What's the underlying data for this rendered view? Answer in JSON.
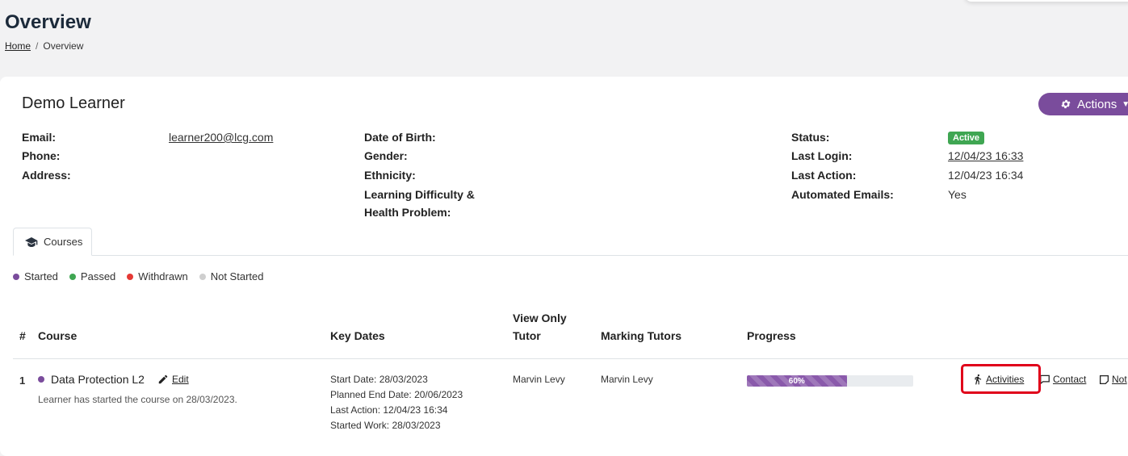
{
  "page": {
    "title": "Overview"
  },
  "breadcrumb": {
    "home": "Home",
    "current": "Overview",
    "separator": "/"
  },
  "learner": {
    "name": "Demo Learner",
    "actions_label": "Actions",
    "col1": [
      {
        "label": "Email:",
        "value": "learner200@lcg.com"
      },
      {
        "label": "Phone:",
        "value": ""
      },
      {
        "label": "Address:",
        "value": ""
      }
    ],
    "col2": [
      {
        "label": "Date of Birth:",
        "value": ""
      },
      {
        "label": "Gender:",
        "value": ""
      },
      {
        "label": "Ethnicity:",
        "value": ""
      },
      {
        "label": "Learning Difficulty &",
        "label2": "Health Problem:",
        "value": ""
      }
    ],
    "col3": [
      {
        "label": "Status:",
        "value": "Active"
      },
      {
        "label": "Last Login:",
        "value": "12/04/23 16:33"
      },
      {
        "label": "Last Action:",
        "value": "12/04/23 16:34"
      },
      {
        "label": "Automated Emails:",
        "value": "Yes"
      }
    ]
  },
  "tabs": [
    {
      "label": "Courses",
      "icon": "graduation-cap-icon"
    }
  ],
  "legend": [
    {
      "label": "Started",
      "color": "#7a4c9c"
    },
    {
      "label": "Passed",
      "color": "#3fa652"
    },
    {
      "label": "Withdrawn",
      "color": "#e53935"
    },
    {
      "label": "Not Started",
      "color": "#cfcfcf"
    }
  ],
  "table": {
    "headers": {
      "num": "#",
      "course": "Course",
      "key_dates": "Key Dates",
      "view_only_1": "View Only",
      "view_only_2": "Tutor",
      "marking": "Marking Tutors",
      "progress": "Progress"
    },
    "rows": [
      {
        "num": "1",
        "course": "Data Protection L2",
        "edit": "Edit",
        "note": "Learner has started the course on 28/03/2023.",
        "dates": [
          "Start Date: 28/03/2023",
          "Planned End Date: 20/06/2023",
          "Last Action: 12/04/23 16:34",
          "Started Work: 28/03/2023"
        ],
        "view_only_tutor": "Marvin Levy",
        "marking_tutors": "Marvin Levy",
        "progress": 60,
        "progress_label": "60%",
        "actions": {
          "activities": "Activities",
          "contact": "Contact",
          "notes": "Not"
        }
      }
    ]
  },
  "colors": {
    "accent": "#7a4c9c",
    "active": "#3fa652",
    "highlight": "#e0001a"
  }
}
